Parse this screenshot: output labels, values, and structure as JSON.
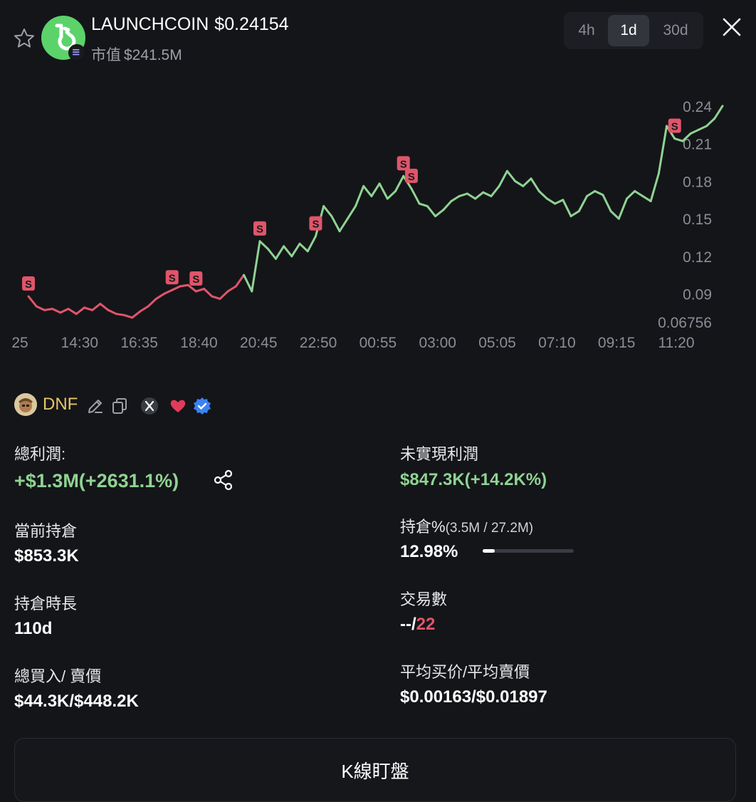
{
  "header": {
    "token_name": "LAUNCHCOIN",
    "price": "$0.24154",
    "market_cap_label": "市值",
    "market_cap_value": "$241.5M",
    "timeframes": [
      "4h",
      "1d",
      "30d"
    ],
    "active_timeframe": "1d",
    "icons": [
      "star-icon",
      "close-icon",
      "solana-chain-icon"
    ]
  },
  "chart_data": {
    "type": "line",
    "x_ticks": [
      "25",
      "14:30",
      "16:35",
      "18:40",
      "20:45",
      "22:50",
      "00:55",
      "03:00",
      "05:05",
      "07:10",
      "09:15",
      "11:20"
    ],
    "y_ticks": [
      "0.24",
      "0.21",
      "0.18",
      "0.15",
      "0.12",
      "0.09",
      "0.06756"
    ],
    "ylim": [
      0.06756,
      0.245
    ],
    "colors": {
      "up": "#8fd392",
      "down": "#e0556a",
      "marker": "#e0556a"
    },
    "series": [
      {
        "values": [
          0.088,
          0.08,
          0.077,
          0.078,
          0.075,
          0.078,
          0.074,
          0.079,
          0.077,
          0.082,
          0.077,
          0.074,
          0.073,
          0.071,
          0.076,
          0.08,
          0.086,
          0.09,
          0.093,
          0.096,
          0.097,
          0.092,
          0.094,
          0.088,
          0.086,
          0.092,
          0.096,
          0.105,
          0.092,
          0.132,
          0.126,
          0.118,
          0.128,
          0.12,
          0.13,
          0.124,
          0.136,
          0.16,
          0.152,
          0.14,
          0.15,
          0.16,
          0.176,
          0.168,
          0.178,
          0.166,
          0.172,
          0.184,
          0.174,
          0.162,
          0.16,
          0.152,
          0.157,
          0.164,
          0.168,
          0.17,
          0.166,
          0.171,
          0.168,
          0.176,
          0.188,
          0.18,
          0.176,
          0.182,
          0.172,
          0.166,
          0.162,
          0.165,
          0.152,
          0.156,
          0.168,
          0.172,
          0.169,
          0.156,
          0.15,
          0.166,
          0.172,
          0.168,
          0.164,
          0.186,
          0.224,
          0.214,
          0.212,
          0.218,
          0.221,
          0.224,
          0.23,
          0.24
        ]
      }
    ],
    "sell_markers": [
      0.093,
      0.1,
      0.104,
      0.137,
      0.13,
      0.178,
      0.186,
      0.226
    ]
  },
  "profile": {
    "name": "DNF",
    "icons": [
      "edit-icon",
      "copy-icon",
      "x-twitter-icon",
      "heart-icon",
      "verified-badge-icon"
    ]
  },
  "stats": {
    "total_profit_label": "總利潤:",
    "total_profit_value": "+$1.3M(+2631.1%)",
    "unrealized_label": "未實現利潤",
    "unrealized_value": "$847.3K(+14.2K%)",
    "current_holding_label": "當前持倉",
    "current_holding_value": "$853.3K",
    "holding_pct_label": "持倉%",
    "holding_pct_sub": "(3.5M / 27.2M)",
    "holding_pct_value": "12.98%",
    "holding_pct_fraction": 0.1298,
    "holding_time_label": "持倉時長",
    "holding_time_value": "110d",
    "trades_label": "交易數",
    "trades_buy": "--/",
    "trades_sell": "22",
    "total_buy_sell_label": "總買入/ 賣價",
    "total_buy_sell_value": "$44.3K/$448.2K",
    "avg_price_label": "平均买价/平均賣價",
    "avg_price_value": "$0.00163/$0.01897"
  },
  "kline_button": "K線盯盤"
}
